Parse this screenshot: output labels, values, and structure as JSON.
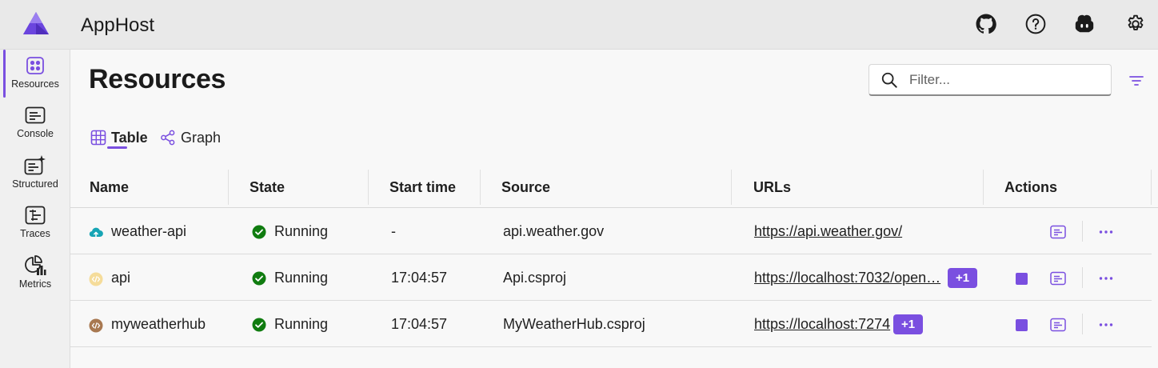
{
  "header": {
    "title": "AppHost",
    "icons": [
      "github-icon",
      "help-icon",
      "copilot-icon",
      "settings-icon"
    ]
  },
  "sidebar": {
    "items": [
      {
        "label": "Resources",
        "icon": "resources-icon",
        "active": true
      },
      {
        "label": "Console",
        "icon": "console-icon"
      },
      {
        "label": "Structured",
        "icon": "structured-icon"
      },
      {
        "label": "Traces",
        "icon": "traces-icon"
      },
      {
        "label": "Metrics",
        "icon": "metrics-icon"
      }
    ]
  },
  "main": {
    "title": "Resources",
    "filter_placeholder": "Filter...",
    "tabs": [
      {
        "label": "Table",
        "active": true
      },
      {
        "label": "Graph"
      }
    ]
  },
  "table": {
    "columns": [
      "Name",
      "State",
      "Start time",
      "Source",
      "URLs",
      "Actions"
    ],
    "rows": [
      {
        "name": "weather-api",
        "state": "Running",
        "start_time": "-",
        "source": "api.weather.gov",
        "url": "https://api.weather.gov/",
        "extra": ""
      },
      {
        "name": "api",
        "state": "Running",
        "start_time": "17:04:57",
        "source": "Api.csproj",
        "url": "https://localhost:7032/open…",
        "extra": "+1"
      },
      {
        "name": "myweatherhub",
        "state": "Running",
        "start_time": "17:04:57",
        "source": "MyWeatherHub.csproj",
        "url": "https://localhost:7274",
        "extra": "+1"
      }
    ]
  },
  "colors": {
    "accent": "#7a4fe0",
    "running": "#107c10"
  }
}
